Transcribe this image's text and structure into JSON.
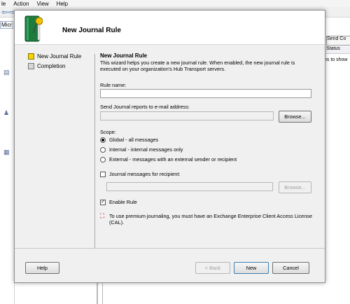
{
  "background": {
    "menu": [
      "le",
      "Action",
      "View",
      "Help"
    ],
    "tree_label": "Micr",
    "send_button": "Send Co",
    "status_header": "Status",
    "side_text": "ns to show"
  },
  "wizard": {
    "title": "New Journal Rule",
    "nav": [
      {
        "label": "New Journal Rule",
        "active": true
      },
      {
        "label": "Completion",
        "active": false
      }
    ],
    "heading": "New Journal Rule",
    "description": "This wizard helps you create a new journal rule. When enabled, the new journal rule is executed on your organization's Hub Transport servers.",
    "rule_name_label": "Rule name:",
    "rule_name_value": "",
    "send_label": "Send Journal reports to e-mail address:",
    "send_value": "",
    "browse_label": "Browse...",
    "scope_label": "Scope:",
    "scope_options": [
      {
        "label": "Global - all messages",
        "selected": true
      },
      {
        "label": "Internal - internal messages only",
        "selected": false
      },
      {
        "label": "External - messages with an external sender or recipient",
        "selected": false
      }
    ],
    "recipient_label": "Journal messages for recipient:",
    "recipient_checked": false,
    "browse2_label": "Browse...",
    "enable_label": "Enable Rule",
    "enable_checked": true,
    "info_text": "To use premium journaling, you must have an Exchange Enterprise Client Access License (CAL).",
    "buttons": {
      "help": "Help",
      "back": "< Back",
      "next": "New",
      "cancel": "Cancel"
    }
  },
  "colors": {
    "active_nav": "#f6d200",
    "info_icon": "#c00000"
  }
}
